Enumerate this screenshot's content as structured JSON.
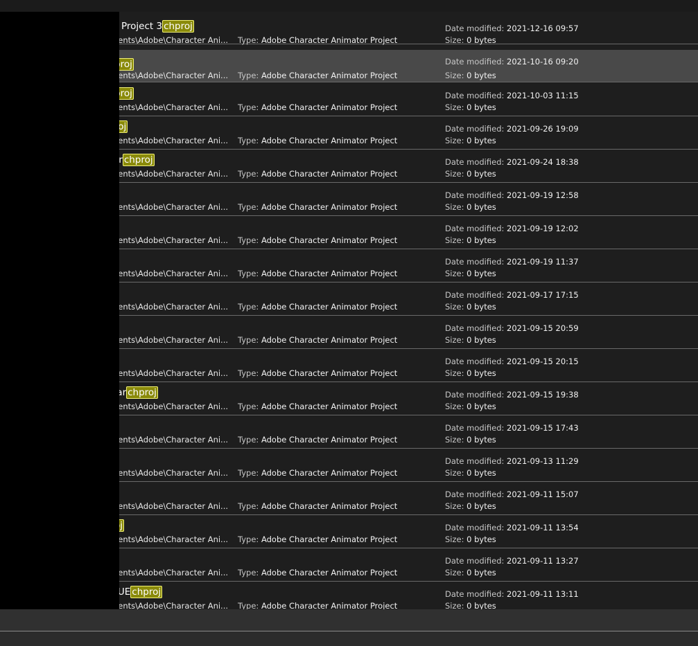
{
  "labels": {
    "type": "Type:",
    "date_modified": "Date modified:",
    "size": "Size:"
  },
  "colors": {
    "highlight_bg": "#8a8a0a",
    "highlight_border": "#f2f277",
    "selected_row": "#494949",
    "row_bg": "#1e1e1e"
  },
  "rows": [
    {
      "name_prefix": "Project 3",
      "name_match": "chproj",
      "path": "nents\\Adobe\\Character Ani...",
      "type": "Adobe Character Animator Project",
      "date": "2021-12-16 09:57",
      "size": "0 bytes"
    },
    {
      "name_prefix": "",
      "name_match": "proj",
      "path": "nents\\Adobe\\Character Ani...",
      "type": "Adobe Character Animator Project",
      "date": "2021-10-16 09:20",
      "size": "0 bytes"
    },
    {
      "name_prefix": "",
      "name_match": "proj",
      "path": "nents\\Adobe\\Character Ani...",
      "type": "Adobe Character Animator Project",
      "date": "2021-10-03 11:15",
      "size": "0 bytes"
    },
    {
      "name_prefix": "",
      "name_match": "roj",
      "path": "nents\\Adobe\\Character Ani...",
      "type": "Adobe Character Animator Project",
      "date": "2021-09-26 19:09",
      "size": "0 bytes"
    },
    {
      "name_prefix": "ar",
      "name_match": "chproj",
      "path": "nents\\Adobe\\Character Ani...",
      "type": "Adobe Character Animator Project",
      "date": "2021-09-24 18:38",
      "size": "0 bytes"
    },
    {
      "name_prefix": "",
      "name_match": "",
      "path": "nents\\Adobe\\Character Ani...",
      "type": "Adobe Character Animator Project",
      "date": "2021-09-19 12:58",
      "size": "0 bytes"
    },
    {
      "name_prefix": "",
      "name_match": "",
      "path": "nents\\Adobe\\Character Ani...",
      "type": "Adobe Character Animator Project",
      "date": "2021-09-19 12:02",
      "size": "0 bytes"
    },
    {
      "name_prefix": "",
      "name_match": "",
      "path": "nents\\Adobe\\Character Ani...",
      "type": "Adobe Character Animator Project",
      "date": "2021-09-19 11:37",
      "size": "0 bytes"
    },
    {
      "name_prefix": "",
      "name_match": "",
      "path": "nents\\Adobe\\Character Ani...",
      "type": "Adobe Character Animator Project",
      "date": "2021-09-17 17:15",
      "size": "0 bytes"
    },
    {
      "name_prefix": "",
      "name_match": "",
      "path": "nents\\Adobe\\Character Ani...",
      "type": "Adobe Character Animator Project",
      "date": "2021-09-15 20:59",
      "size": "0 bytes"
    },
    {
      "name_prefix": "",
      "name_match": "",
      "path": "nents\\Adobe\\Character Ani...",
      "type": "Adobe Character Animator Project",
      "date": "2021-09-15 20:15",
      "size": "0 bytes"
    },
    {
      "name_prefix": "tar",
      "name_match": "chproj",
      "path": "nents\\Adobe\\Character Ani...",
      "type": "Adobe Character Animator Project",
      "date": "2021-09-15 19:38",
      "size": "0 bytes"
    },
    {
      "name_prefix": "",
      "name_match": "",
      "path": "nents\\Adobe\\Character Ani...",
      "type": "Adobe Character Animator Project",
      "date": "2021-09-15 17:43",
      "size": "0 bytes"
    },
    {
      "name_prefix": "",
      "name_match": "",
      "path": "nents\\Adobe\\Character Ani...",
      "type": "Adobe Character Animator Project",
      "date": "2021-09-13 11:29",
      "size": "0 bytes"
    },
    {
      "name_prefix": "",
      "name_match": "j",
      "path": "nents\\Adobe\\Character Ani...",
      "type": "Adobe Character Animator Project",
      "date": "2021-09-11 15:07",
      "size": "0 bytes"
    },
    {
      "name_prefix": "",
      "name_match": "oj",
      "path": "nents\\Adobe\\Character Ani...",
      "type": "Adobe Character Animator Project",
      "date": "2021-09-11 13:54",
      "size": "0 bytes"
    },
    {
      "name_prefix": "",
      "name_match": "",
      "path": "nents\\Adobe\\Character Ani...",
      "type": "Adobe Character Animator Project",
      "date": "2021-09-11 13:27",
      "size": "0 bytes"
    },
    {
      "name_prefix": "LUE",
      "name_match": "chproj",
      "path": "nents\\Adobe\\Character Ani...",
      "type": "Adobe Character Animator Project",
      "date": "2021-09-11 13:11",
      "size": "0 bytes"
    }
  ]
}
